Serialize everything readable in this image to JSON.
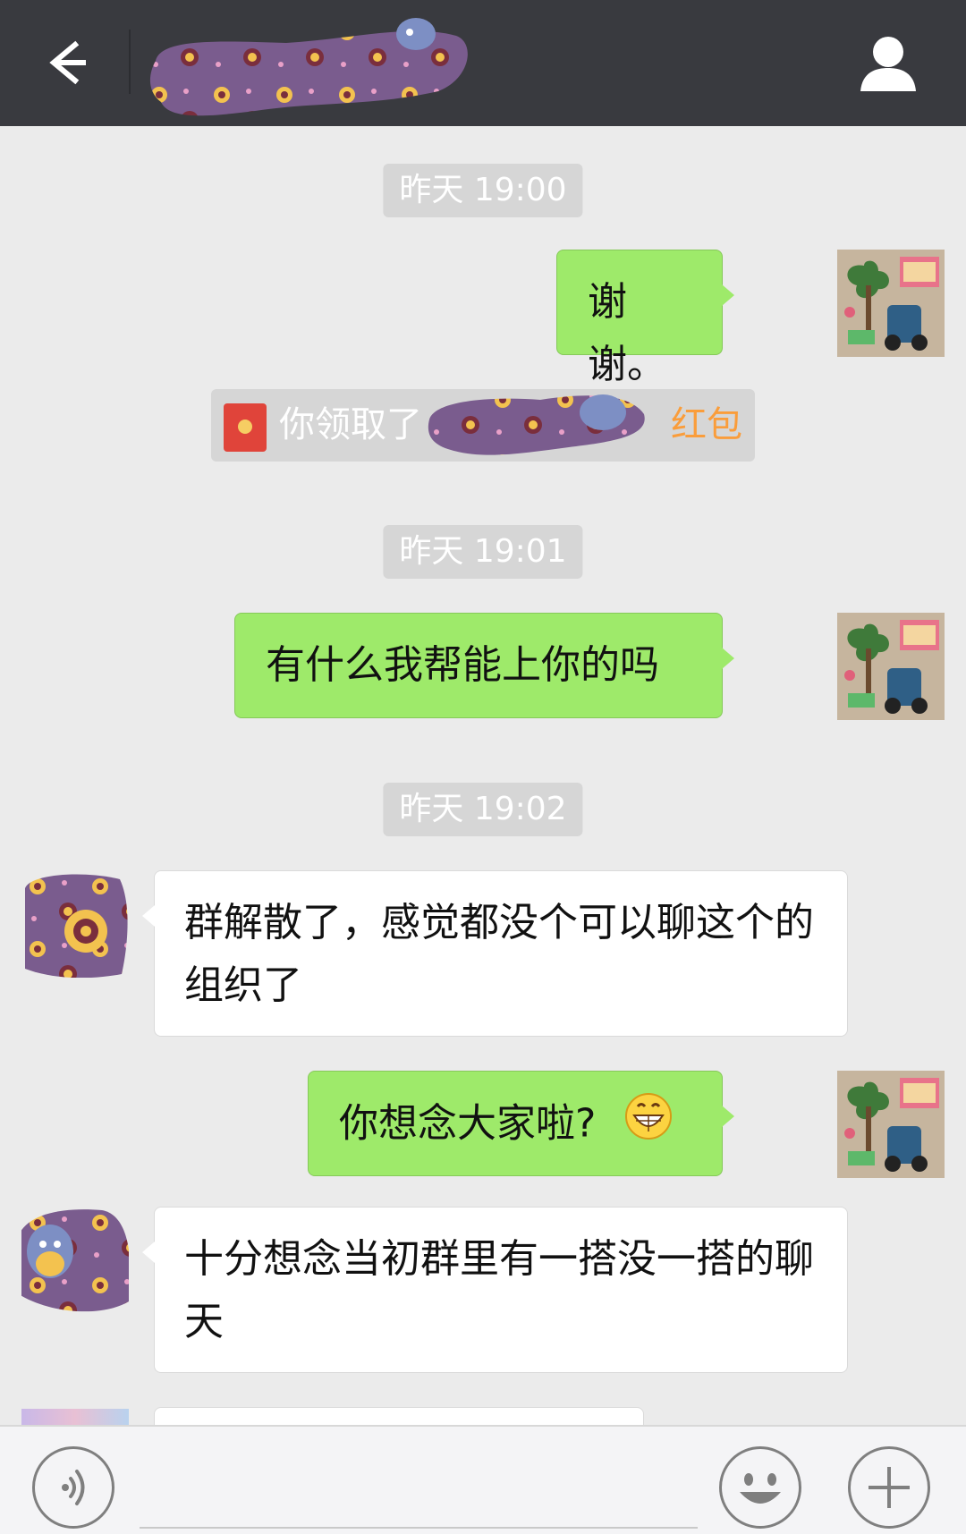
{
  "header": {
    "back_icon": "arrow-left-icon",
    "title": "",
    "profile_icon": "person-icon"
  },
  "messages": {
    "ts1": "昨天 19:00",
    "msg1": "谢谢。",
    "redpacket": {
      "prefix": "你领取了",
      "link": "红包",
      "icon": "red-packet-icon"
    },
    "ts2": "昨天 19:01",
    "msg2": "有什么我帮能上你的吗",
    "ts3": "昨天 19:02",
    "msg3": "群解散了，感觉都没个可以聊这个的组织了",
    "msg4": "你想念大家啦?",
    "msg4_emoji": "grin-emoji",
    "msg5": "十分想念当初群里有一搭没一搭的聊天"
  },
  "input_bar": {
    "voice_icon": "voice-icon",
    "emoji_icon": "smile-icon",
    "plus_icon": "plus-icon"
  },
  "colors": {
    "header_bg": "#393a3f",
    "chat_bg": "#ebebeb",
    "my_bubble": "#9eea6a",
    "their_bubble": "#ffffff",
    "link_orange": "#fa9d3b",
    "red_packet": "#e0443a"
  }
}
